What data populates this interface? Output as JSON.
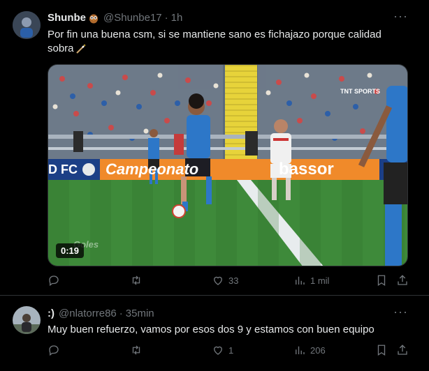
{
  "tweets": [
    {
      "name": "Shunbe",
      "handle": "@Shunbe17",
      "time": "1h",
      "text_line1": "Por fin una buena csm, si se mantiene sano es fichajazo porque calidad",
      "text_line2": "sobra",
      "media": {
        "duration": "0:19",
        "banner_left": "D FC",
        "banner_mid": "Campeonato",
        "banner_right": "bassor",
        "banner_tv": "TNT SPORTS",
        "watermark": "Goles"
      },
      "actions": {
        "replies": "",
        "retweets": "",
        "likes": "33",
        "views": "1 mil"
      }
    },
    {
      "name": ":)",
      "handle": "@nlatorre86",
      "time": "35min",
      "text": "Muy buen refuerzo, vamos por esos dos 9 y estamos con buen equipo",
      "actions": {
        "replies": "",
        "retweets": "",
        "likes": "1",
        "views": "206"
      }
    }
  ],
  "icons": [
    "reply-icon",
    "retweet-icon",
    "like-icon",
    "views-icon",
    "bookmark-icon",
    "share-icon",
    "more-icon",
    "owl-emoji-icon",
    "wand-emoji-icon"
  ],
  "colors": {
    "background": "#000000",
    "text": "#e7e9ea",
    "secondary": "#71767b",
    "border": "#2f3336"
  }
}
